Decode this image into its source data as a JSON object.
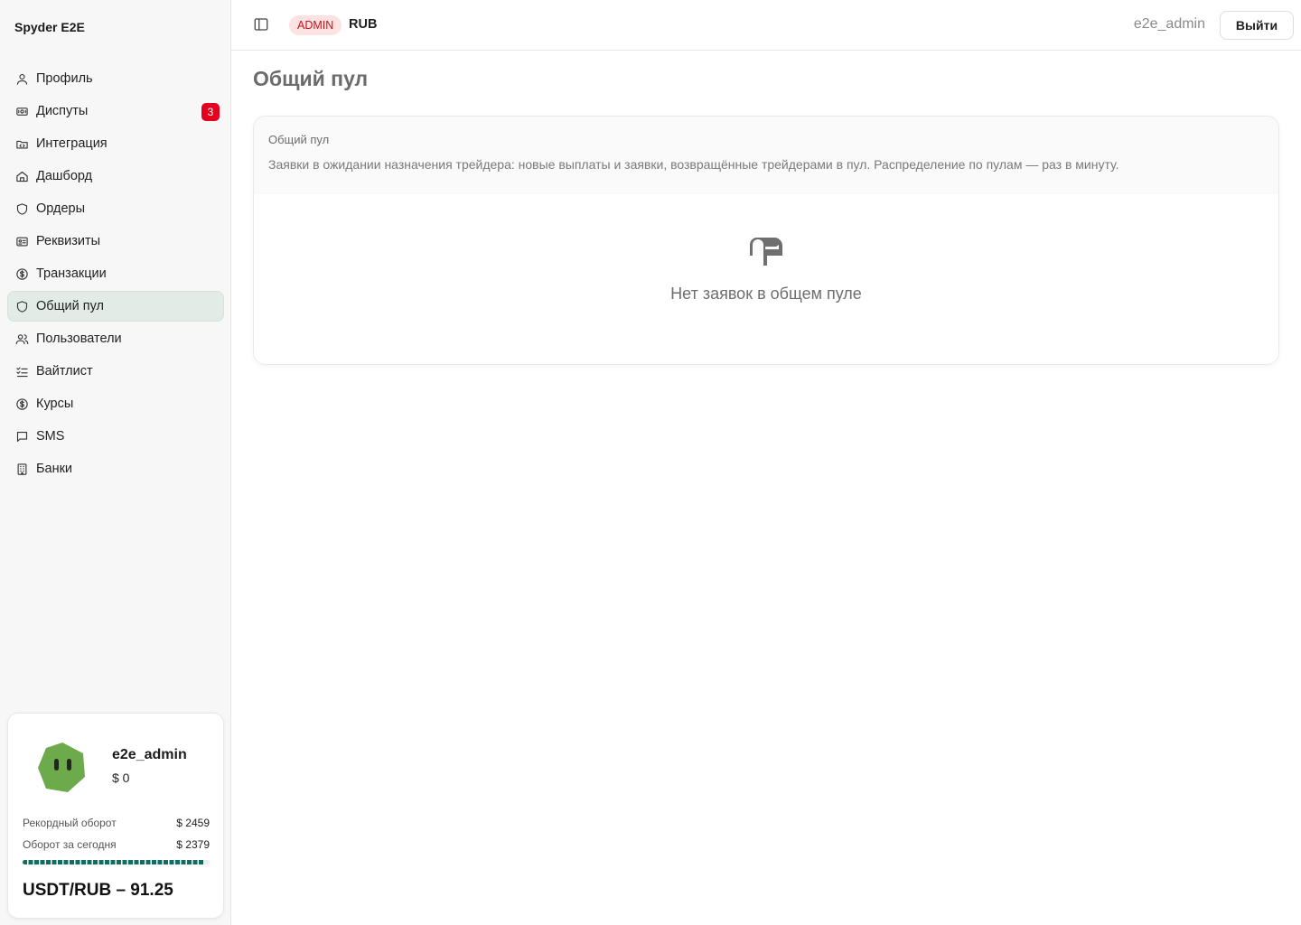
{
  "app": {
    "brand": "Spyder E2E"
  },
  "sidebar": {
    "items": [
      {
        "label": "Профиль",
        "icon": "user-icon"
      },
      {
        "label": "Диспуты",
        "icon": "ticket-icon",
        "badge": "3"
      },
      {
        "label": "Интеграция",
        "icon": "folder-code-icon"
      },
      {
        "label": "Дашборд",
        "icon": "home-icon"
      },
      {
        "label": "Ордеры",
        "icon": "shield-icon"
      },
      {
        "label": "Реквизиты",
        "icon": "id-card-icon"
      },
      {
        "label": "Транзакции",
        "icon": "dollar-circle-icon"
      },
      {
        "label": "Общий пул",
        "icon": "shield-icon",
        "active": true
      },
      {
        "label": "Пользователи",
        "icon": "users-icon"
      },
      {
        "label": "Вайтлист",
        "icon": "list-check-icon"
      },
      {
        "label": "Курсы",
        "icon": "dollar-circle-icon"
      },
      {
        "label": "SMS",
        "icon": "message-square-icon"
      },
      {
        "label": "Банки",
        "icon": "building-icon"
      }
    ]
  },
  "user_card": {
    "name": "e2e_admin",
    "balance": "$ 0",
    "record_label": "Рекордный оборот",
    "record_value": "$ 2459",
    "today_label": "Оборот за сегодня",
    "today_value": "$ 2379",
    "turnover_progress": 0.97,
    "rate": "USDT/RUB – 91.25"
  },
  "topbar": {
    "role": "ADMIN",
    "currency": "RUB",
    "username": "e2e_admin",
    "logout_label": "Выйти"
  },
  "main": {
    "page_title": "Общий пул",
    "panel_title": "Общий пул",
    "panel_description": "Заявки в ожидании назначения трейдера: новые выплаты и заявки, возвращённые трейдерами в пул. Распределение по пулам — раз в минуту.",
    "empty_text": "Нет заявок в общем пуле"
  },
  "colors": {
    "accent": "#0e6e61",
    "badge_red": "#e4001f",
    "admin_badge_bg": "#fde2e2",
    "admin_badge_text": "#c4121a",
    "avatar_green": "#6daa4b"
  }
}
